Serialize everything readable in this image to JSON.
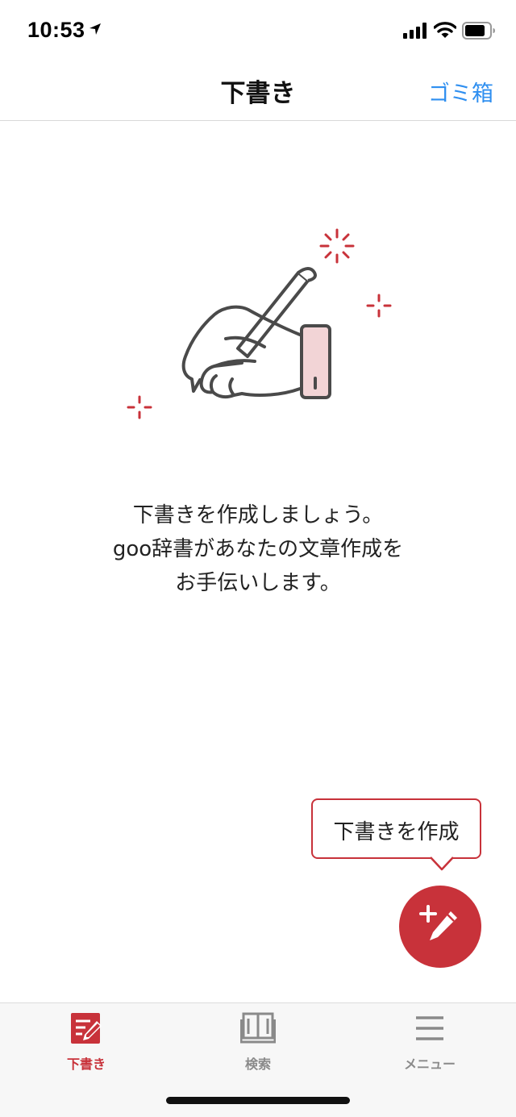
{
  "status_bar": {
    "time": "10:53",
    "icons": [
      "location-arrow-icon",
      "cellular-signal-icon",
      "wifi-icon",
      "battery-icon"
    ]
  },
  "nav": {
    "title": "下書き",
    "trash_label": "ゴミ箱"
  },
  "empty_state": {
    "illustration": "hand-writing-with-pen-icon",
    "lines": [
      "下書きを作成しましょう。",
      "goo辞書があなたの文章作成を",
      "お手伝いします。"
    ]
  },
  "tooltip": {
    "text": "下書きを作成"
  },
  "fab": {
    "icon": "add-draft-pen-icon"
  },
  "tab_bar": {
    "active": "drafts",
    "tabs": [
      {
        "id": "drafts",
        "label": "下書き",
        "icon": "draft-note-icon"
      },
      {
        "id": "search",
        "label": "検索",
        "icon": "dictionary-book-icon"
      },
      {
        "id": "menu",
        "label": "メニュー",
        "icon": "hamburger-menu-icon"
      }
    ]
  },
  "colors": {
    "accent_red": "#c8323a",
    "link_blue": "#2f8ff0",
    "inactive_gray": "#8a8a8a",
    "illustration_pink": "#f2d4d6"
  }
}
